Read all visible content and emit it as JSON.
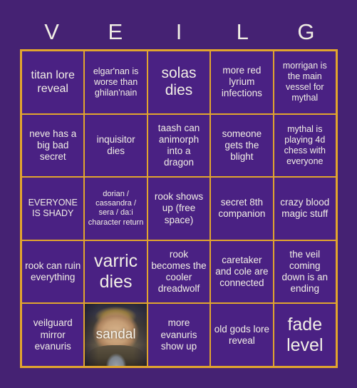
{
  "page": {
    "background_color": "#452273",
    "cell_background_color": "#4A2183",
    "border_color": "#E2A52E",
    "text_color": "#F2EFE6"
  },
  "header": {
    "letters": [
      "V",
      "E",
      "I",
      "L",
      "G"
    ]
  },
  "grid": {
    "rows": 5,
    "columns": 5,
    "cells": [
      {
        "text": "titan lore reveal",
        "size": "lg",
        "type": "text"
      },
      {
        "text": "elgar'nan is worse than ghilan'nain",
        "size": "sm",
        "type": "text"
      },
      {
        "text": "solas dies",
        "size": "xl",
        "type": "text"
      },
      {
        "text": "more red lyrium infections",
        "size": "md",
        "type": "text"
      },
      {
        "text": "morrigan is the main vessel for mythal",
        "size": "sm",
        "type": "text"
      },
      {
        "text": "neve has a big bad secret",
        "size": "md",
        "type": "text"
      },
      {
        "text": "inquisitor dies",
        "size": "md",
        "type": "text"
      },
      {
        "text": "taash can animorph into a dragon",
        "size": "md",
        "type": "text"
      },
      {
        "text": "someone gets the blight",
        "size": "md",
        "type": "text"
      },
      {
        "text": "mythal is playing 4d chess with everyone",
        "size": "sm",
        "type": "text"
      },
      {
        "text": "EVERYONE IS SHADY",
        "size": "sm",
        "type": "text"
      },
      {
        "text": "dorian / cassandra / sera / da:i character return",
        "size": "xs",
        "type": "text"
      },
      {
        "text": "rook shows up (free space)",
        "size": "md",
        "type": "text"
      },
      {
        "text": "secret 8th companion",
        "size": "md",
        "type": "text"
      },
      {
        "text": "crazy blood magic stuff",
        "size": "md",
        "type": "text"
      },
      {
        "text": "rook can ruin everything",
        "size": "md",
        "type": "text"
      },
      {
        "text": "varric dies",
        "size": "xxl",
        "type": "text"
      },
      {
        "text": "rook becomes the cooler dreadwolf",
        "size": "md",
        "type": "text"
      },
      {
        "text": "caretaker and cole are connected",
        "size": "md",
        "type": "text"
      },
      {
        "text": "the veil coming down is an ending",
        "size": "md",
        "type": "text"
      },
      {
        "text": "veilguard mirror evanuris",
        "size": "md",
        "type": "text"
      },
      {
        "text": "sandal",
        "size": "lg",
        "type": "image",
        "image_name": "sandal-portrait"
      },
      {
        "text": "more evanuris show up",
        "size": "md",
        "type": "text"
      },
      {
        "text": "old gods lore reveal",
        "size": "md",
        "type": "text"
      },
      {
        "text": "fade level",
        "size": "xxl",
        "type": "text"
      }
    ]
  }
}
